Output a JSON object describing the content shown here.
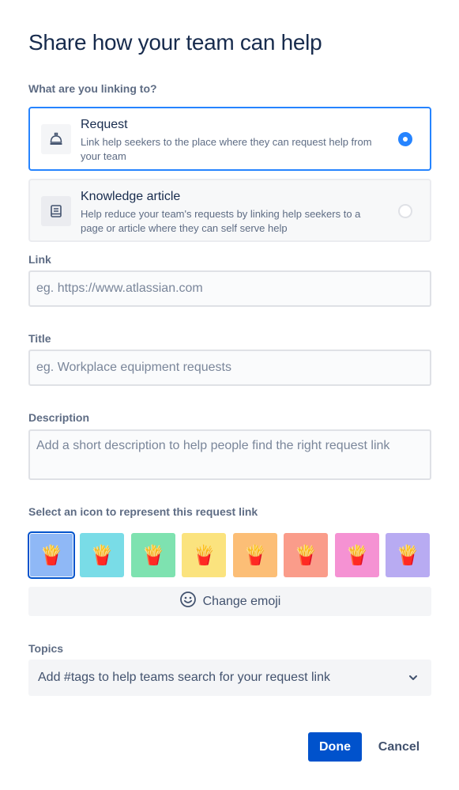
{
  "dialog": {
    "title": "Share how your team can help"
  },
  "link_type": {
    "label": "What are you linking to?",
    "options": [
      {
        "title": "Request",
        "description": "Link help seekers to the place where they can request help from your team",
        "icon": "service-bell-icon",
        "selected": true
      },
      {
        "title": "Knowledge article",
        "description": "Help reduce your team's requests by linking help seekers to a page or article where they can self serve help",
        "icon": "book-icon",
        "selected": false
      }
    ]
  },
  "link_field": {
    "label": "Link",
    "placeholder": "eg. https://www.atlassian.com",
    "value": ""
  },
  "title_field": {
    "label": "Title",
    "placeholder": "eg. Workplace equipment requests",
    "value": ""
  },
  "description_field": {
    "label": "Description",
    "placeholder": "Add a short description to help people find the right request link",
    "value": ""
  },
  "icon_picker": {
    "label": "Select an icon to represent this request link",
    "emoji": "🍟",
    "swatches": [
      {
        "color": "#8FB8F6",
        "selected": true
      },
      {
        "color": "#79DCE7",
        "selected": false
      },
      {
        "color": "#7EE2B0",
        "selected": false
      },
      {
        "color": "#FBE37E",
        "selected": false
      },
      {
        "color": "#FCBE76",
        "selected": false
      },
      {
        "color": "#FA9C8A",
        "selected": false
      },
      {
        "color": "#F592D3",
        "selected": false
      },
      {
        "color": "#B8ABF2",
        "selected": false
      }
    ],
    "change_button": "Change emoji"
  },
  "topics": {
    "label": "Topics",
    "placeholder": "Add #tags to help teams search for your request link"
  },
  "footer": {
    "done_label": "Done",
    "cancel_label": "Cancel"
  },
  "colors": {
    "primary": "#0052CC",
    "focus": "#2684FF",
    "text": "#172B4D",
    "subtle": "#5E6C84"
  }
}
